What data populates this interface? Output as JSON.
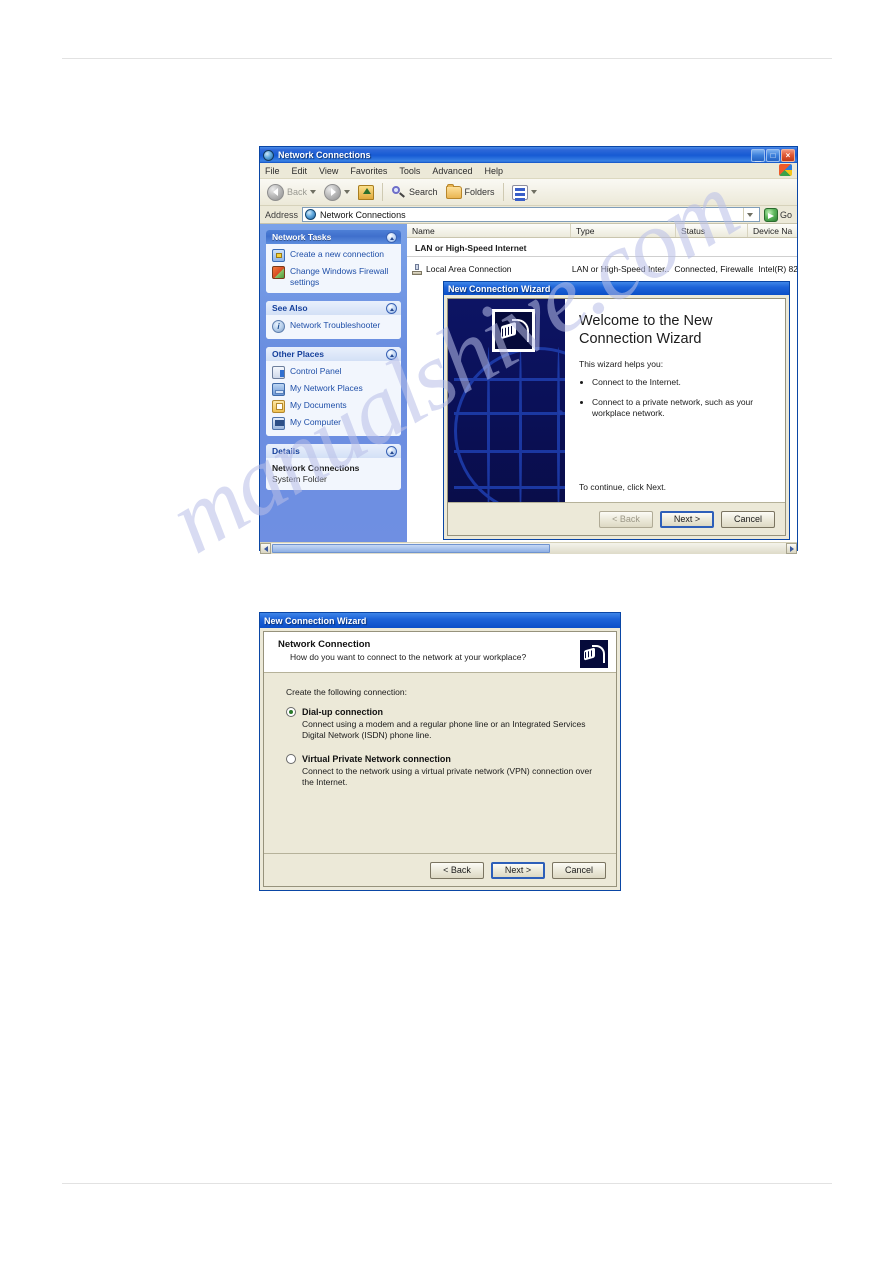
{
  "watermark": "manualshive.com",
  "explorer": {
    "title": "Network Connections",
    "title_icon": "network-globe-icon",
    "window_buttons": {
      "minimize": "_",
      "maximize": "□",
      "close": "×"
    },
    "menus": [
      "File",
      "Edit",
      "View",
      "Favorites",
      "Tools",
      "Advanced",
      "Help"
    ],
    "toolbar": {
      "back": "Back",
      "forward": "",
      "up": "",
      "search": "Search",
      "folders": "Folders",
      "views": ""
    },
    "address": {
      "label": "Address",
      "value": "Network Connections",
      "go_label": "Go"
    },
    "sidebar": {
      "panels": [
        {
          "title": "Network Tasks",
          "style": "blue",
          "items": [
            {
              "label": "Create a new connection",
              "icon": "new-connection-icon"
            },
            {
              "label": "Change Windows Firewall settings",
              "icon": "firewall-icon"
            }
          ]
        },
        {
          "title": "See Also",
          "style": "light",
          "items": [
            {
              "label": "Network Troubleshooter",
              "icon": "troubleshooter-icon"
            }
          ]
        },
        {
          "title": "Other Places",
          "style": "light",
          "items": [
            {
              "label": "Control Panel",
              "icon": "control-panel-icon"
            },
            {
              "label": "My Network Places",
              "icon": "network-places-icon"
            },
            {
              "label": "My Documents",
              "icon": "my-documents-icon"
            },
            {
              "label": "My Computer",
              "icon": "my-computer-icon"
            }
          ]
        },
        {
          "title": "Details",
          "style": "light",
          "detail_title": "Network Connections",
          "detail_sub": "System Folder"
        }
      ]
    },
    "list": {
      "columns": [
        "Name",
        "Type",
        "Status",
        "Device Na"
      ],
      "group": "LAN or High-Speed Internet",
      "rows": [
        {
          "name": "Local Area Connection",
          "type": "LAN or High-Speed Inter...",
          "status": "Connected, Firewalled",
          "device": "Intel(R) 82"
        }
      ]
    }
  },
  "wizard_welcome": {
    "title": "New Connection Wizard",
    "heading": "Welcome to the New Connection Wizard",
    "intro": "This wizard helps you:",
    "bullets": [
      "Connect to the Internet.",
      "Connect to a private network, such as your workplace network."
    ],
    "continue_text": "To continue, click Next.",
    "buttons": {
      "back": "< Back",
      "next": "Next >",
      "cancel": "Cancel"
    }
  },
  "wizard_network": {
    "title": "New Connection Wizard",
    "header_title": "Network Connection",
    "header_sub": "How do you want to connect to the network at your workplace?",
    "lead": "Create the following connection:",
    "options": [
      {
        "label": "Dial-up connection",
        "selected": true,
        "description": "Connect using a modem and a regular phone line or an Integrated Services Digital Network (ISDN) phone line."
      },
      {
        "label": "Virtual Private Network connection",
        "selected": false,
        "description": "Connect to the network using a virtual private network (VPN) connection over the Internet."
      }
    ],
    "buttons": {
      "back": "< Back",
      "next": "Next >",
      "cancel": "Cancel"
    }
  }
}
